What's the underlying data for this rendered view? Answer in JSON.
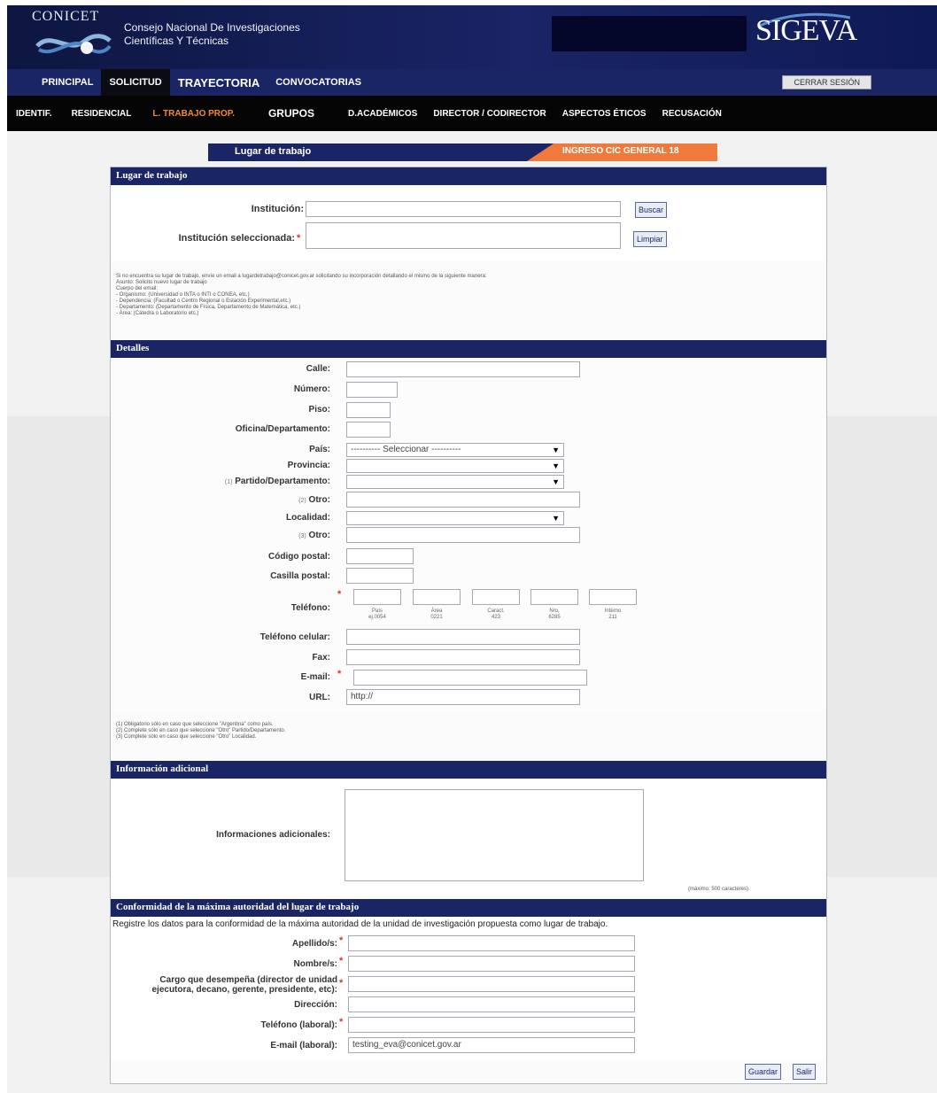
{
  "header": {
    "logo_text": "CONICET",
    "org_line1": "Consejo Nacional De Investigaciones",
    "org_line2": "Científicas Y Técnicas",
    "brand": "SIGEVA"
  },
  "main_nav": {
    "items": [
      "PRINCIPAL",
      "SOLICITUD",
      "TRAYECTORIA",
      "CONVOCATORIAS"
    ],
    "active": "SOLICITUD",
    "logout": "CERRAR SESIÓN"
  },
  "sub_nav": {
    "items": [
      "IDENTIF.",
      "RESIDENCIAL",
      "L. TRABAJO PROP.",
      "GRUPOS",
      "D.ACADÉMICOS",
      "DIRECTOR / CODIRECTOR",
      "ASPECTOS ÉTICOS",
      "RECUSACIÓN"
    ],
    "active": "L. TRABAJO PROP."
  },
  "title_bar": {
    "label": "Lugar de trabajo",
    "call": "INGRESO CIC GENERAL 18"
  },
  "lugar": {
    "header": "Lugar de trabajo",
    "institucion_label": "Institución:",
    "institucion_value": "",
    "buscar": "Buscar",
    "seleccionada_label": "Institución seleccionada:",
    "seleccionada_value": "",
    "limpiar": "Limpiar",
    "note": [
      "Si no encuentra su lugar de trabajo, envíe un email a lugardetrabajo@conicet.gov.ar solicitando su incorporación detallando el mismo de la siguiente manera:",
      "Asunto: Solicito nuevo lugar de trabajo",
      "Cuerpo del email:",
      "- Organismo: (Universidad o INTA o INTI o CONEA, etc.)",
      "- Dependencia: (Facultad o Centro Regional o Estación Experimental,etc.)",
      "- Departamento: (Departamento de Física, Departamento de Matemática, etc.)",
      "- Área: (Cátedra o Laboratorio etc.)"
    ]
  },
  "detalles": {
    "header": "Detalles",
    "calle": "Calle:",
    "numero": "Número:",
    "piso": "Piso:",
    "oficina": "Oficina/Departamento:",
    "pais": "País:",
    "pais_value": "---------- Seleccionar ----------",
    "provincia": "Provincia:",
    "partido_prefix": "(1)",
    "partido": "Partido/Departamento:",
    "otro1_prefix": "(2)",
    "otro": "Otro:",
    "localidad": "Localidad:",
    "otro2_prefix": "(3)",
    "codigo_postal": "Código postal:",
    "casilla_postal": "Casilla postal:",
    "telefono": "Teléfono:",
    "tel_parts": [
      {
        "l1": "País",
        "l2": "ej.0054"
      },
      {
        "l1": "Área",
        "l2": "0221"
      },
      {
        "l1": "Caract.",
        "l2": "423"
      },
      {
        "l1": "Nro.",
        "l2": "6285"
      },
      {
        "l1": "Interno",
        "l2": "211"
      }
    ],
    "telefono_celular": "Teléfono celular:",
    "fax": "Fax:",
    "email": "E-mail:",
    "url": "URL:",
    "url_value": "http://",
    "footnotes": [
      "(1) Obligatorio sólo en caso que seleccione \"Argentina\" como país.",
      "(2) Complete sólo en caso que seleccione \"Otro\" Partido/Departamento.",
      "(3) Complete sólo en caso que seleccione \"Otro\" Localidad."
    ]
  },
  "info_adicional": {
    "header": "Información adicional",
    "label": "Informaciones adicionales:",
    "max": "(máximo: 500 caracteres)"
  },
  "conformidad": {
    "header": "Conformidad de la máxima autoridad del lugar de trabajo",
    "intro": "Registre los datos para la conformidad de la máxima autoridad de la unidad de investigación propuesta como lugar de trabajo.",
    "apellidos": "Apellido/s:",
    "nombres": "Nombre/s:",
    "cargo_l1": "Cargo que desempeña (director de unidad",
    "cargo_l2": "ejecutora, decano, gerente, presidente, etc):",
    "direccion": "Dirección:",
    "telefono_laboral": "Teléfono (laboral):",
    "email_laboral": "E-mail (laboral):",
    "email_value": "testing_eva@conicet.gov.ar"
  },
  "footer": {
    "guardar": "Guardar",
    "salir": "Salir"
  }
}
